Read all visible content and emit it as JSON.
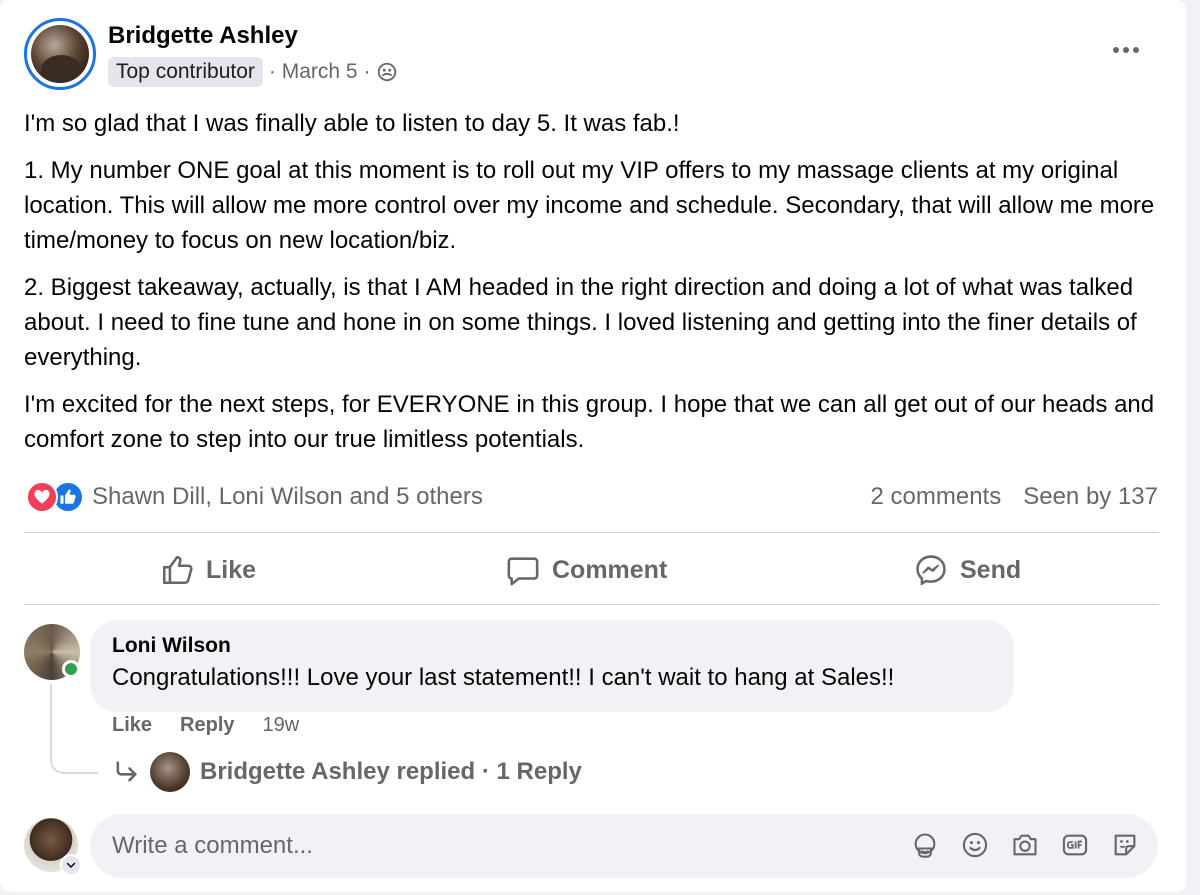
{
  "post": {
    "author": "Bridgette Ashley",
    "badge": "Top contributor",
    "date": "· March 5 ·",
    "paragraphs": [
      "I'm so glad that I was finally able to listen to day 5. It was fab.!",
      "1. My number ONE goal at this moment is to roll out my VIP offers to my massage clients at my original location. This will allow me more control over my income and schedule. Secondary, that will allow me more time/money to focus on new location/biz.",
      "2. Biggest takeaway, actually, is that I AM headed in the right direction and doing a lot of what was talked about. I need to fine tune and hone in on some things. I loved listening and getting into the finer details of everything.",
      "I'm excited for the next steps, for EVERYONE in this group. I hope that we can all get out of our heads and comfort zone to step into our true limitless potentials."
    ],
    "reactions_text": "Shawn Dill, Loni Wilson and 5 others",
    "comments_count": "2 comments",
    "seen_by": "Seen by 137"
  },
  "actions": {
    "like": "Like",
    "comment": "Comment",
    "send": "Send"
  },
  "comment": {
    "author": "Loni Wilson",
    "text": "Congratulations!!! Love your last statement!! I can't wait to hang at Sales!!",
    "like": "Like",
    "reply": "Reply",
    "age": "19w",
    "replies_summary": "Bridgette Ashley replied · 1 Reply"
  },
  "composer": {
    "placeholder": "Write a comment..."
  },
  "colors": {
    "accent": "#1b74e4",
    "love": "#f33e58",
    "secondary_text": "#65676b",
    "online": "#31a24c"
  }
}
